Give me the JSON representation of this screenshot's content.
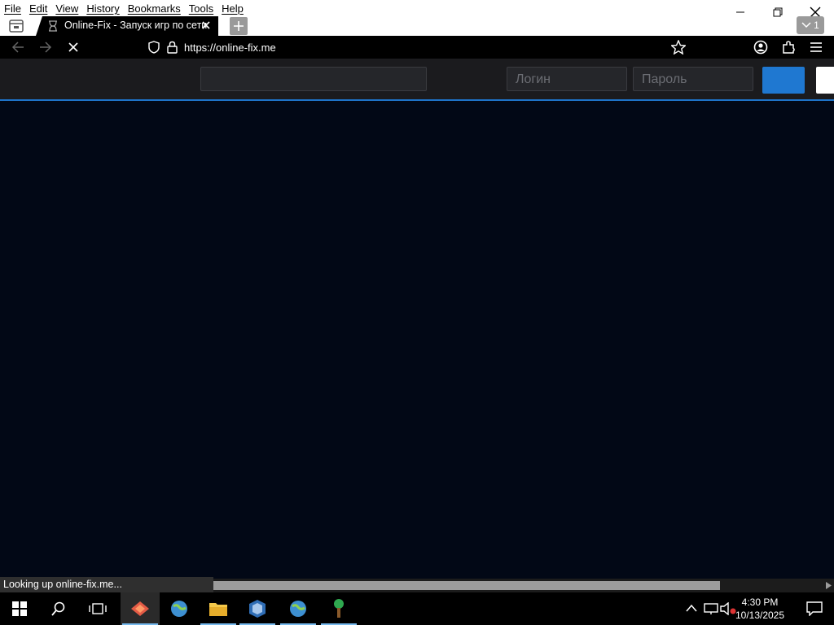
{
  "browser": {
    "menu": [
      "File",
      "Edit",
      "View",
      "History",
      "Bookmarks",
      "Tools",
      "Help"
    ],
    "tab": {
      "title": "Online-Fix - Запуск игр по сети"
    },
    "tab_count": "1",
    "url": "https://online-fix.me",
    "status": "Looking up online-fix.me..."
  },
  "site": {
    "search_placeholder": "",
    "login_placeholder": "Логин",
    "password_placeholder": "Пароль"
  },
  "taskbar": {
    "time": "4:30 PM",
    "date": "10/13/2025"
  },
  "colors": {
    "accent": "#1f78d1",
    "page_background": "#020816",
    "header_background": "#1b1b1e"
  },
  "icons": [
    "file-overview-icon",
    "hourglass-icon",
    "close-icon",
    "plus-icon",
    "chevron-down-icon",
    "back-arrow-icon",
    "forward-arrow-icon",
    "stop-icon",
    "shield-icon",
    "lock-icon",
    "star-icon",
    "account-icon",
    "extensions-icon",
    "hamburger-menu-icon",
    "windows-start-icon",
    "search-icon",
    "task-view-icon",
    "firefox-icon",
    "globe-icon",
    "folder-icon",
    "virtualbox-icon",
    "tree-icon",
    "chevron-up-icon",
    "network-icon",
    "volume-muted-icon",
    "notification-icon"
  ]
}
